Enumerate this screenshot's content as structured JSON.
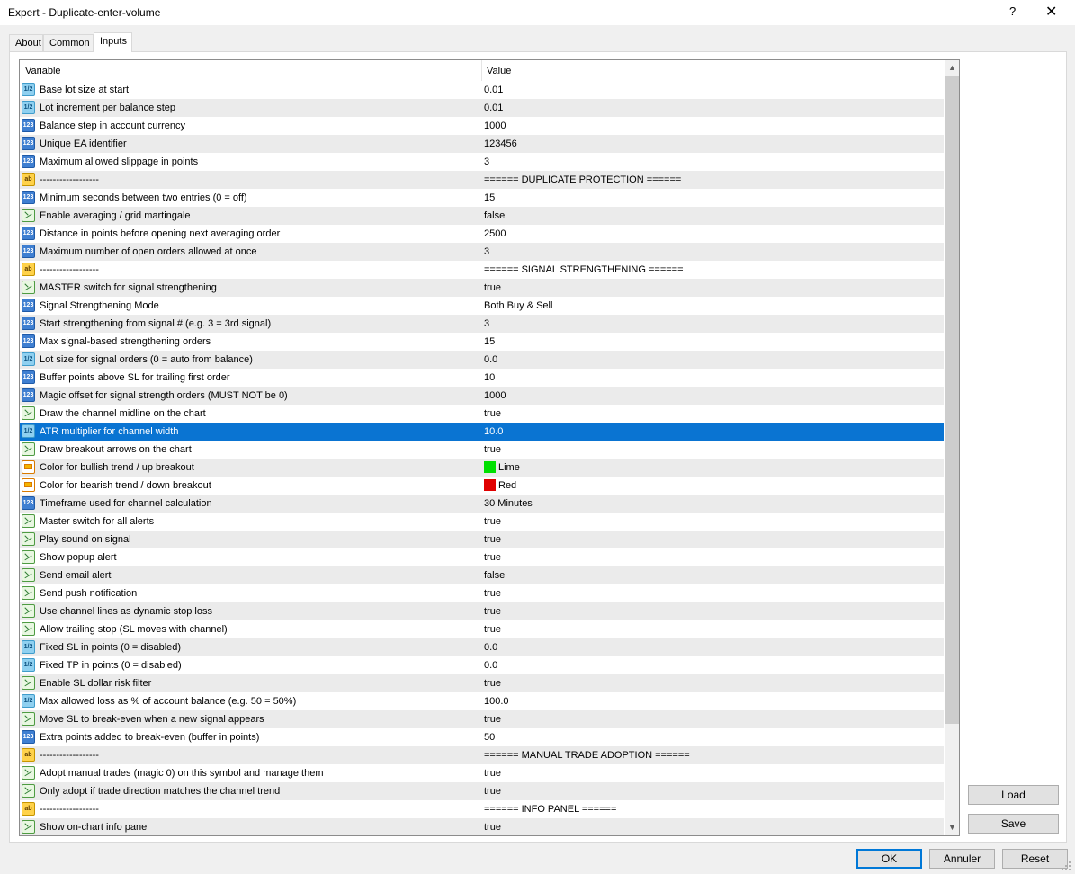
{
  "window": {
    "title": "Expert - Duplicate-enter-volume",
    "help": "?",
    "close": "✕"
  },
  "tabs": [
    {
      "label": "About"
    },
    {
      "label": "Common"
    },
    {
      "label": "Inputs"
    }
  ],
  "grid": {
    "headers": {
      "variable": "Variable",
      "value": "Value"
    },
    "rows": [
      {
        "type": "double",
        "name": "Base lot size at start",
        "value": "0.01"
      },
      {
        "type": "double",
        "name": "Lot increment per balance step",
        "value": "0.01"
      },
      {
        "type": "int",
        "name": "Balance step in account currency",
        "value": "1000"
      },
      {
        "type": "int",
        "name": "Unique EA identifier",
        "value": "123456"
      },
      {
        "type": "int",
        "name": "Maximum allowed slippage in points",
        "value": "3"
      },
      {
        "type": "string",
        "name": "------------------",
        "value": "====== DUPLICATE PROTECTION ======"
      },
      {
        "type": "int",
        "name": "Minimum seconds between two entries (0 = off)",
        "value": "15"
      },
      {
        "type": "bool",
        "name": "Enable averaging / grid martingale",
        "value": "false"
      },
      {
        "type": "int",
        "name": "Distance in points before opening next averaging order",
        "value": "2500"
      },
      {
        "type": "int",
        "name": "Maximum number of open orders allowed at once",
        "value": "3"
      },
      {
        "type": "string",
        "name": "------------------",
        "value": "====== SIGNAL STRENGTHENING ======"
      },
      {
        "type": "bool",
        "name": "MASTER switch for signal strengthening",
        "value": "true"
      },
      {
        "type": "int",
        "name": "Signal Strengthening Mode",
        "value": "Both Buy & Sell"
      },
      {
        "type": "int",
        "name": "Start strengthening from signal # (e.g. 3 = 3rd signal)",
        "value": "3"
      },
      {
        "type": "int",
        "name": "Max signal-based strengthening orders",
        "value": "15"
      },
      {
        "type": "double",
        "name": "Lot size for signal orders (0 = auto from balance)",
        "value": "0.0"
      },
      {
        "type": "int",
        "name": "Buffer points above SL for trailing first order",
        "value": "10"
      },
      {
        "type": "int",
        "name": "Magic offset for signal strength orders (MUST NOT be 0)",
        "value": "1000"
      },
      {
        "type": "bool",
        "name": "Draw the channel midline on the chart",
        "value": "true"
      },
      {
        "type": "double",
        "name": "ATR multiplier for channel width",
        "value": "10.0",
        "selected": true
      },
      {
        "type": "bool",
        "name": "Draw breakout arrows on the chart",
        "value": "true"
      },
      {
        "type": "color",
        "name": "Color for bullish trend / up breakout",
        "value": "Lime",
        "swatch": "#00e000"
      },
      {
        "type": "color",
        "name": "Color for bearish trend / down breakout",
        "value": "Red",
        "swatch": "#e00000"
      },
      {
        "type": "int",
        "name": "Timeframe used for channel calculation",
        "value": "30 Minutes"
      },
      {
        "type": "bool",
        "name": "Master switch for all alerts",
        "value": "true"
      },
      {
        "type": "bool",
        "name": "Play sound on signal",
        "value": "true"
      },
      {
        "type": "bool",
        "name": "Show popup alert",
        "value": "true"
      },
      {
        "type": "bool",
        "name": "Send email alert",
        "value": "false"
      },
      {
        "type": "bool",
        "name": "Send push notification",
        "value": "true"
      },
      {
        "type": "bool",
        "name": "Use channel lines as dynamic stop loss",
        "value": "true"
      },
      {
        "type": "bool",
        "name": "Allow trailing stop (SL moves with channel)",
        "value": "true"
      },
      {
        "type": "double",
        "name": "Fixed SL in points (0 = disabled)",
        "value": "0.0"
      },
      {
        "type": "double",
        "name": "Fixed TP in points (0 = disabled)",
        "value": "0.0"
      },
      {
        "type": "bool",
        "name": "Enable SL dollar risk filter",
        "value": "true"
      },
      {
        "type": "double",
        "name": "Max allowed loss as % of account balance (e.g. 50 = 50%)",
        "value": "100.0"
      },
      {
        "type": "bool",
        "name": "Move SL to break-even when a new signal appears",
        "value": "true"
      },
      {
        "type": "int",
        "name": "Extra points added to break-even (buffer in points)",
        "value": "50"
      },
      {
        "type": "string",
        "name": "------------------",
        "value": "====== MANUAL TRADE ADOPTION ======"
      },
      {
        "type": "bool",
        "name": "Adopt manual trades (magic 0) on this symbol and manage them",
        "value": "true"
      },
      {
        "type": "bool",
        "name": "Only adopt if trade direction matches the channel trend",
        "value": "true"
      },
      {
        "type": "string",
        "name": "------------------",
        "value": "====== INFO PANEL ======"
      },
      {
        "type": "bool",
        "name": "Show on-chart info panel",
        "value": "true"
      }
    ]
  },
  "icons": {
    "int": "123",
    "double": "1/2",
    "string": "ab",
    "bool": "",
    "color": ""
  },
  "buttons": {
    "load": "Load",
    "save": "Save",
    "ok": "OK",
    "cancel": "Annuler",
    "reset": "Reset"
  },
  "scrollbar": {
    "up": "▲",
    "down": "▼"
  }
}
